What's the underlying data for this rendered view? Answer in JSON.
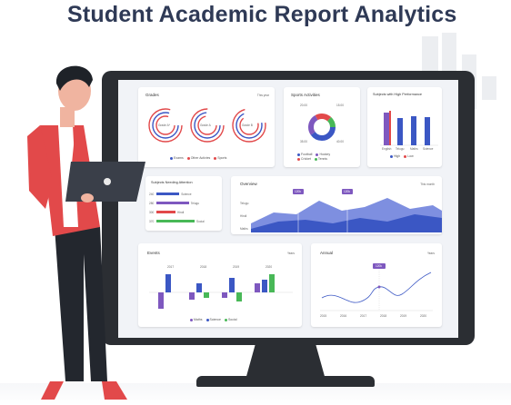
{
  "title": "Student Academic Report Analytics",
  "colors": {
    "dark": "#2f3a56",
    "blue": "#3b57c4",
    "purple": "#7e58bf",
    "red": "#e2494a",
    "green": "#48b857"
  },
  "grades": {
    "title": "Grades",
    "dropdown": "This year",
    "rings": [
      {
        "label": "Grade A*"
      },
      {
        "label": "Grade A"
      },
      {
        "label": "Grade B"
      }
    ],
    "legend": [
      "Exams",
      "Other Activies",
      "Sports"
    ]
  },
  "sports": {
    "title": "Sports Activities",
    "values": [
      "20.00",
      "15.00",
      "35.00",
      "40.00"
    ],
    "legend": [
      "Football",
      "Hockey",
      "Cricket",
      "Tennis"
    ]
  },
  "subjects_high": {
    "title": "Subjects with High Performance",
    "categories": [
      "English",
      "Telugu",
      "Maths",
      "Science"
    ],
    "legend": [
      "High",
      "Low"
    ]
  },
  "subjects_attention": {
    "title": "Subjects Needing Attention",
    "rows": [
      {
        "code": "240",
        "label": "Science",
        "value": 60,
        "color": "#3b57c4"
      },
      {
        "code": "280",
        "label": "Telugu",
        "value": 85,
        "color": "#7e58bf"
      },
      {
        "code": "300",
        "label": "Hindi",
        "value": 50,
        "color": "#e2494a"
      },
      {
        "code": "370",
        "label": "Social",
        "value": 100,
        "color": "#48b857"
      }
    ]
  },
  "overview": {
    "title": "Overview",
    "dropdown": "This month",
    "labels": [
      "Telugu",
      "Hindi",
      "Maths"
    ],
    "tags": [
      "120k",
      "120k"
    ]
  },
  "events": {
    "title": "Events",
    "dropdown": "Years",
    "years": [
      "2017",
      "2018",
      "2019",
      "2020"
    ],
    "legend": [
      "Maths",
      "Science",
      "Social"
    ]
  },
  "annual": {
    "title": "Annual",
    "dropdown": "Years",
    "tag": "120k",
    "xlabels": [
      "2015",
      "2016",
      "2017",
      "2018",
      "2019",
      "2020"
    ]
  }
}
